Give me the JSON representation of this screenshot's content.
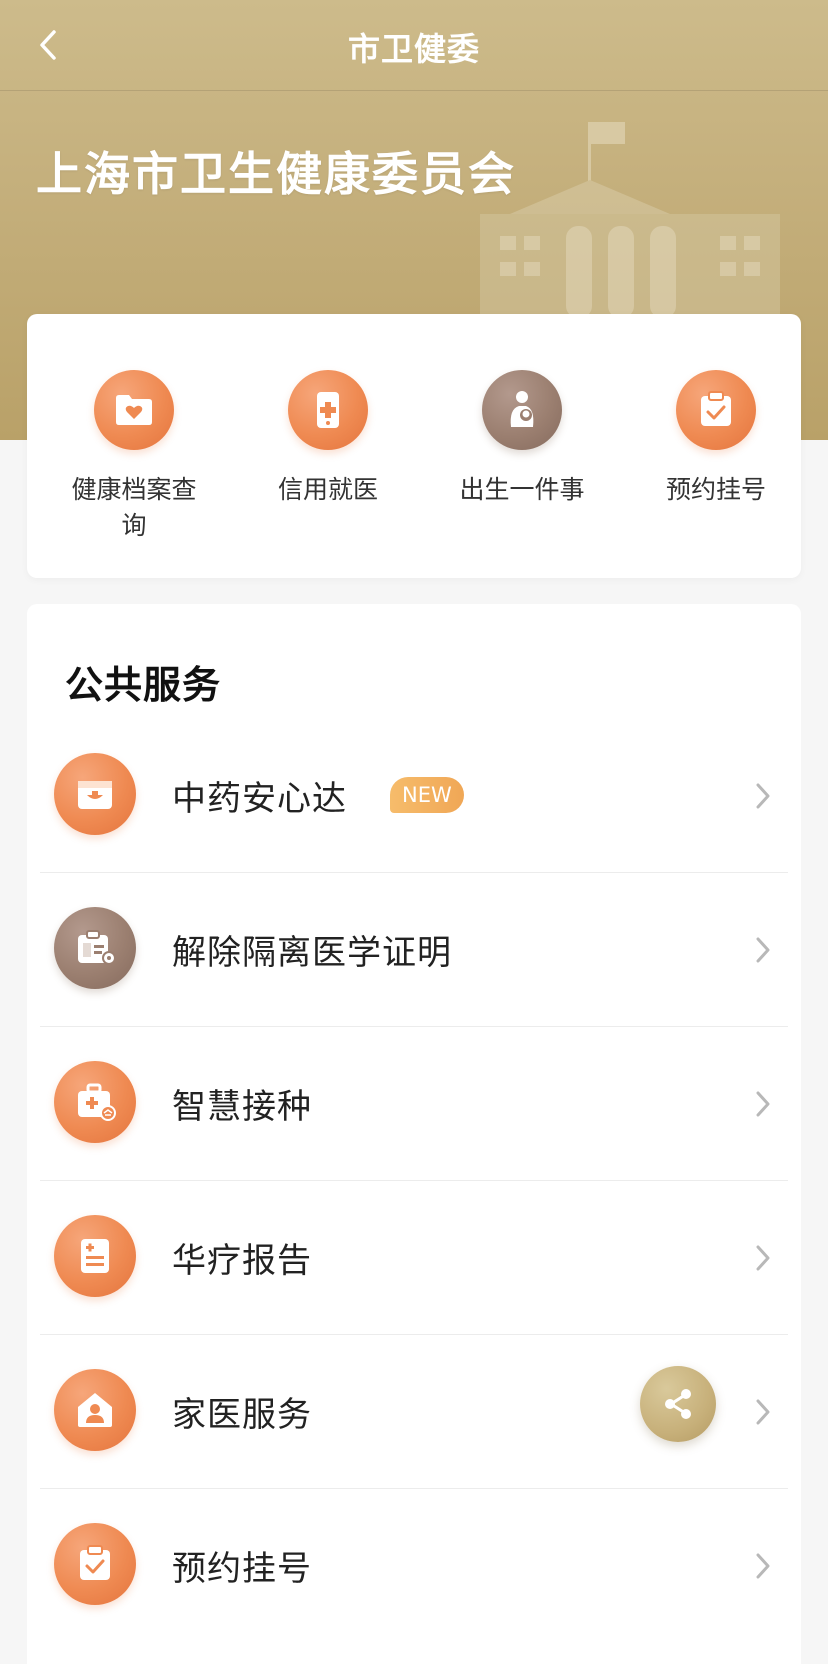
{
  "navbar": {
    "title": "市卫健委",
    "back_icon": "chevron-left-icon"
  },
  "banner": {
    "org_name": "上海市卫生健康委员会",
    "illustration": "building-icon",
    "colors": {
      "gold_top": "#cdbb8b",
      "gold_bottom": "#b9a168"
    }
  },
  "quick_actions": [
    {
      "label": "健康档案查询",
      "icon": "folder-heart-icon",
      "color": "#ef8a52"
    },
    {
      "label": "信用就医",
      "icon": "phone-plus-icon",
      "color": "#ef8a52"
    },
    {
      "label": "出生一件事",
      "icon": "mother-baby-icon",
      "color": "#9b7f70"
    },
    {
      "label": "预约挂号",
      "icon": "clipboard-check-icon",
      "color": "#ef8a52"
    }
  ],
  "public_services": {
    "title": "公共服务",
    "items": [
      {
        "label": "中药安心达",
        "icon": "herbal-box-icon",
        "badge": "NEW",
        "color": "#ef8a52"
      },
      {
        "label": "解除隔离医学证明",
        "icon": "certificate-icon",
        "badge": "",
        "color": "#9b7f70"
      },
      {
        "label": "智慧接种",
        "icon": "medical-kit-icon",
        "badge": "",
        "color": "#ef8a52"
      },
      {
        "label": "华疗报告",
        "icon": "report-icon",
        "badge": "",
        "color": "#ef8a52"
      },
      {
        "label": "家医服务",
        "icon": "home-doctor-icon",
        "badge": "",
        "color": "#ef8a52"
      },
      {
        "label": "预约挂号",
        "icon": "clipboard-check-icon",
        "badge": "",
        "color": "#ef8a52"
      }
    ]
  },
  "floating": {
    "share_icon": "share-icon"
  }
}
